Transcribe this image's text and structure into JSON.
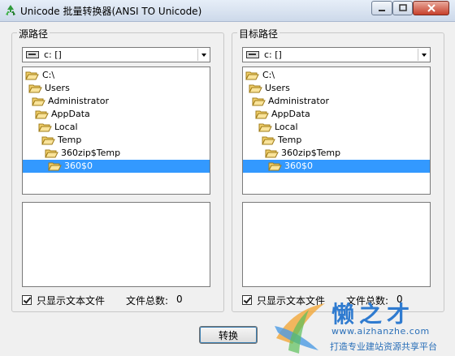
{
  "window": {
    "title": "Unicode 批量转换器(ANSI TO Unicode)"
  },
  "source": {
    "group_title": "源路径",
    "drive": "c: []",
    "tree": [
      "C:\\",
      "Users",
      "Administrator",
      "AppData",
      "Local",
      "Temp",
      "360zip$Temp",
      "360$0"
    ],
    "show_text_only": "只显示文本文件",
    "count_label": "文件总数:",
    "count_value": "0"
  },
  "target": {
    "group_title": "目标路径",
    "drive": "c: []",
    "tree": [
      "C:\\",
      "Users",
      "Administrator",
      "AppData",
      "Local",
      "Temp",
      "360zip$Temp",
      "360$0"
    ],
    "show_text_only": "只显示文本文件",
    "count_label": "文件总数:",
    "count_value": "0"
  },
  "actions": {
    "convert": "转换"
  },
  "watermark": {
    "brand": "懒之才",
    "url": "www.aizhanzhe.com",
    "slogan": "打造专业建站资源共享平台"
  },
  "colors": {
    "selection": "#3399ff",
    "folder": "#f5d76e",
    "watermark_blue": "#2f7bd0"
  }
}
